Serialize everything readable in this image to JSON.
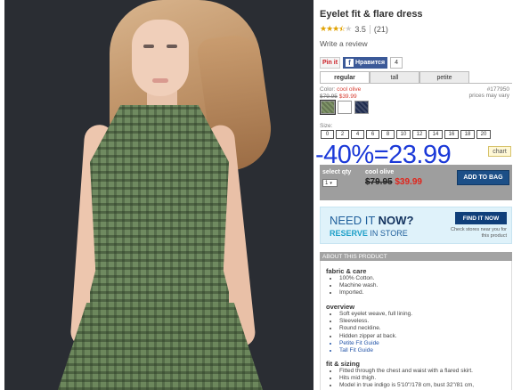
{
  "product": {
    "title": "Eyelet fit & flare dress",
    "rating_value": "3.5",
    "review_count": "(21)",
    "stars": 3.5,
    "write_review": "Write a review"
  },
  "social": {
    "pin_label": "Pin it",
    "fb_label": "Нравится",
    "fb_count": "4"
  },
  "tabs": [
    "regular",
    "tall",
    "petite"
  ],
  "color": {
    "label": "Color:",
    "value": "cool olive",
    "sku": "#177950",
    "sku_note": "prices may vary",
    "old_price": "$79.95",
    "new_price": "$39.99",
    "swatches": [
      "#7f9468",
      "#ffffff",
      "#1f2c4e"
    ]
  },
  "size": {
    "label": "Size:",
    "options": [
      "0",
      "2",
      "4",
      "6",
      "8",
      "10",
      "12",
      "14",
      "16",
      "18",
      "20"
    ],
    "chart": "chart"
  },
  "promo_text": "-40%=23.99",
  "buy": {
    "qty_label": "select qty",
    "qty_value": "1",
    "color_name": "cool olive",
    "old_price": "$79.95",
    "new_price": "$39.99",
    "add_button": "ADD TO BAG"
  },
  "banner": {
    "need": "NEED IT ",
    "now": "NOW?",
    "reserve": "RESERVE",
    "in_store": " IN STORE",
    "find_button": "FIND IT NOW",
    "find_sub": "Check stores near you for this product"
  },
  "about": {
    "header": "ABOUT THIS PRODUCT",
    "care_title": "fabric & care",
    "care": [
      "100% Cotton.",
      "Machine wash.",
      "Imported."
    ],
    "overview_title": "overview",
    "overview": [
      "Soft eyelet weave, full lining.",
      "Sleeveless.",
      "Round neckline.",
      "Hidden zipper at back."
    ],
    "fit_links": [
      "Petite Fit Guide",
      "Tall Fit Guide"
    ],
    "fit_title": "fit & sizing",
    "fit": [
      "Fitted through the chest and waist with a flared skirt.",
      "Hits mid thigh.",
      "Model in true indigo is 5'10\"/178 cm, bust 32\"/81 cm,"
    ]
  }
}
